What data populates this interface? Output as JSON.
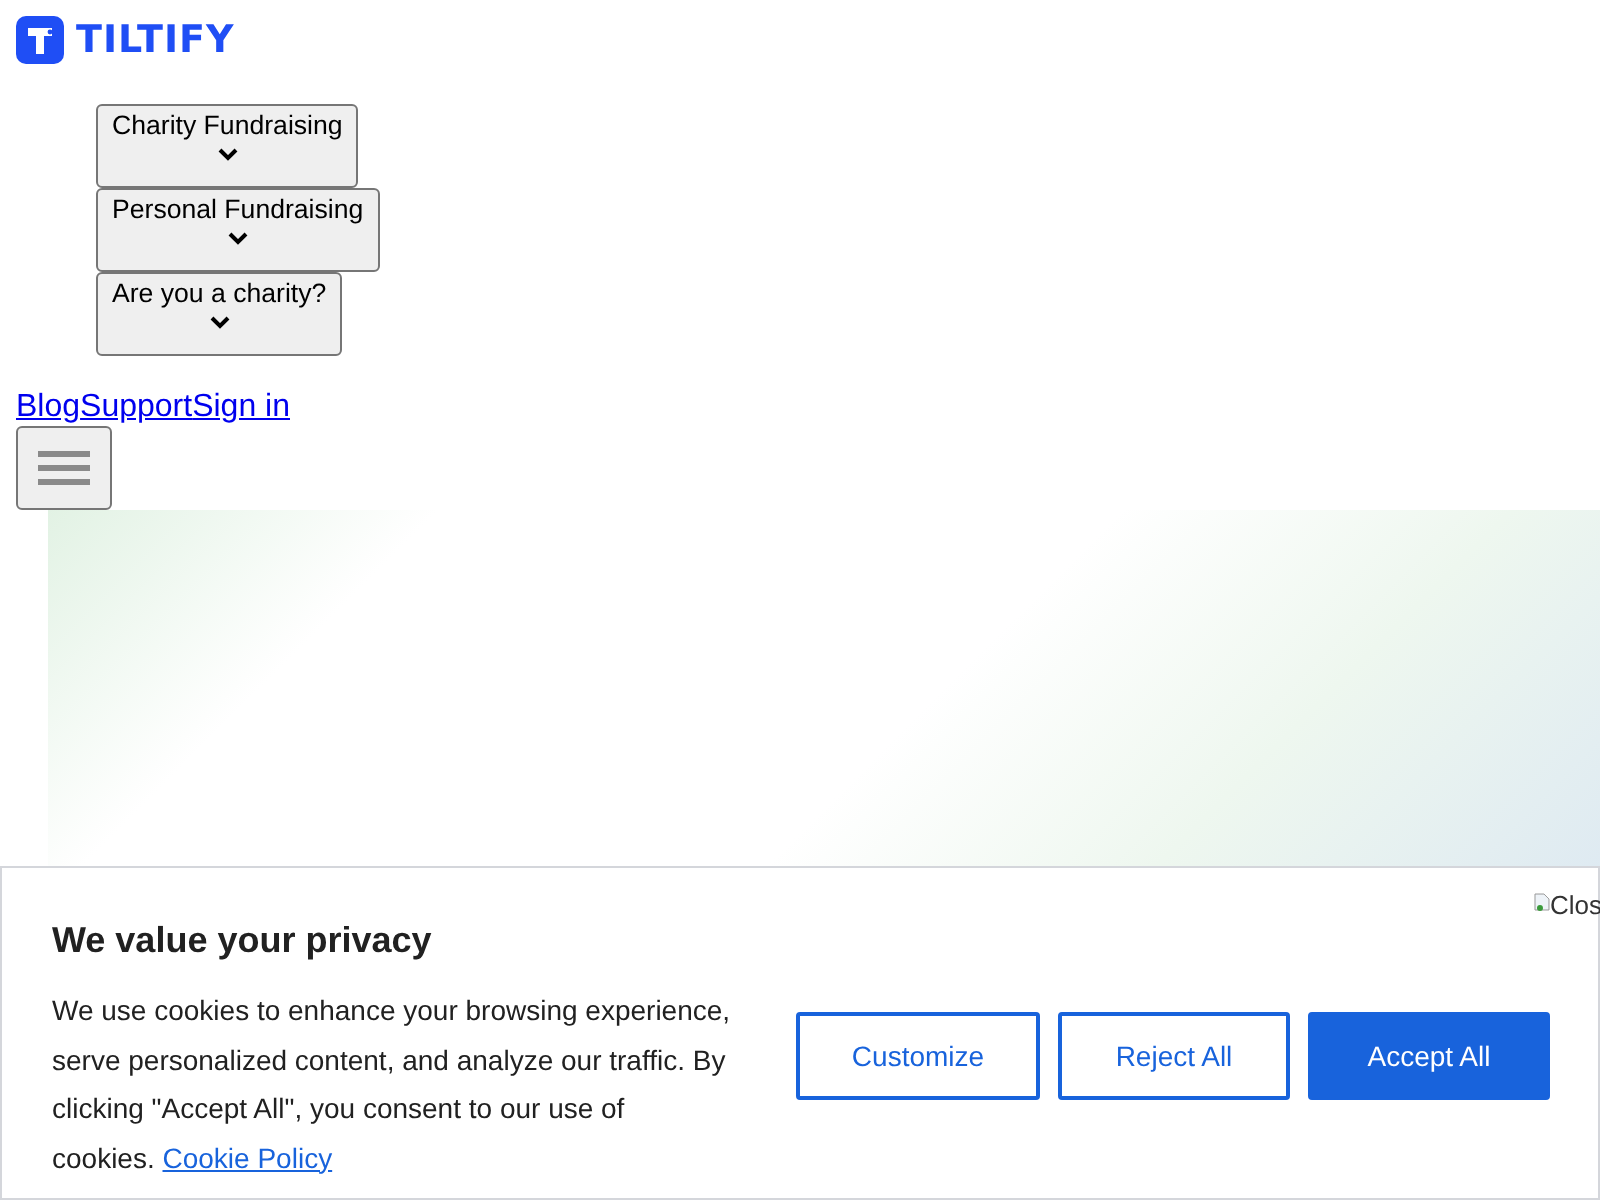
{
  "header": {
    "logo_text": "TILTIFY"
  },
  "nav_menus": [
    {
      "label": "Charity Fundraising",
      "expanded": false
    },
    {
      "label": "Personal Fundraising",
      "expanded": false
    },
    {
      "label": "Are you a charity?",
      "expanded": false
    }
  ],
  "nav_links": [
    "Blog",
    "Support",
    "Sign in"
  ],
  "cookie_banner": {
    "title": "We value your privacy",
    "text": "We use cookies to enhance your browsing experience, serve personalized content, and analyze our traffic. By clicking \"Accept All\", you consent to our use of cookies.",
    "policy_link": "Cookie Policy",
    "close_alt": "Clos",
    "buttons": [
      {
        "label": "Customize",
        "kind": "outline"
      },
      {
        "label": "Reject All",
        "kind": "outline"
      },
      {
        "label": "Accept All",
        "kind": "primary"
      }
    ]
  }
}
